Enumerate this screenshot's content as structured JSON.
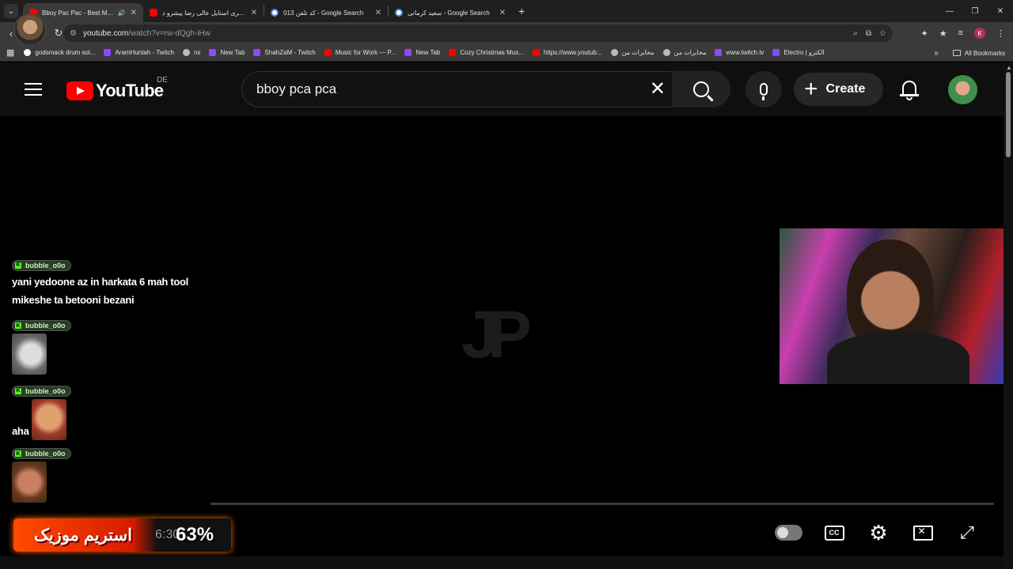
{
  "tabs": [
    {
      "title": "Bboy Pac Pac - Best Moments",
      "icon": "youtube-icon",
      "active": true,
      "audio": true
    },
    {
      "title": "یه فری استایل عالی رضا پیشرو د...",
      "icon": "youtube-icon"
    },
    {
      "title": "کد تلفن 013 - Google Search",
      "icon": "google-icon"
    },
    {
      "title": "سعید کرمانی - Google Search",
      "icon": "google-icon"
    }
  ],
  "address": {
    "host": "youtube.com",
    "path": "/watch?v=rw-dQgh-iHw"
  },
  "bookmarks": [
    {
      "label": "godsmack drum sol...",
      "icon": "google"
    },
    {
      "label": "AramHuntah - Twitch",
      "icon": "twitch"
    },
    {
      "label": "ns",
      "icon": "globe"
    },
    {
      "label": "New Tab",
      "icon": "twitch"
    },
    {
      "label": "ShahZaM - Twitch",
      "icon": "twitch"
    },
    {
      "label": "Music for Work — P...",
      "icon": "youtube"
    },
    {
      "label": "New Tab",
      "icon": "twitch"
    },
    {
      "label": "Cozy Christmas Mus...",
      "icon": "youtube"
    },
    {
      "label": "https://www.youtub...",
      "icon": "youtube"
    },
    {
      "label": "مخابرات من",
      "icon": "globe"
    },
    {
      "label": "مخابرات من",
      "icon": "globe"
    },
    {
      "label": "www.twitch.tv",
      "icon": "twitch"
    },
    {
      "label": "Electro | الکترو",
      "icon": "electro"
    }
  ],
  "all_bookmarks": "All Bookmarks",
  "profile_letter": "K",
  "youtube": {
    "logo_text": "YouTube",
    "country": "DE",
    "search_query": "bboy pca pca",
    "create_label": "Create"
  },
  "video": {
    "watermark": "JP",
    "chat": [
      {
        "user": "bubble_o0o",
        "text": "yani yedoone az in harkata 6 mah tool",
        "text2": "mikeshe ta betooni bezani"
      },
      {
        "user": "bubble_o0o"
      },
      {
        "user": "bubble_o0o",
        "text": "aha"
      },
      {
        "user": "bubble_o0o"
      }
    ],
    "banner_text": "استریم موزیک",
    "time": "6:30",
    "percent": "63%"
  },
  "colors": {
    "yt_red": "#ff0000",
    "kick_green": "#53fc18",
    "banner_orange": "#ff4a00"
  }
}
